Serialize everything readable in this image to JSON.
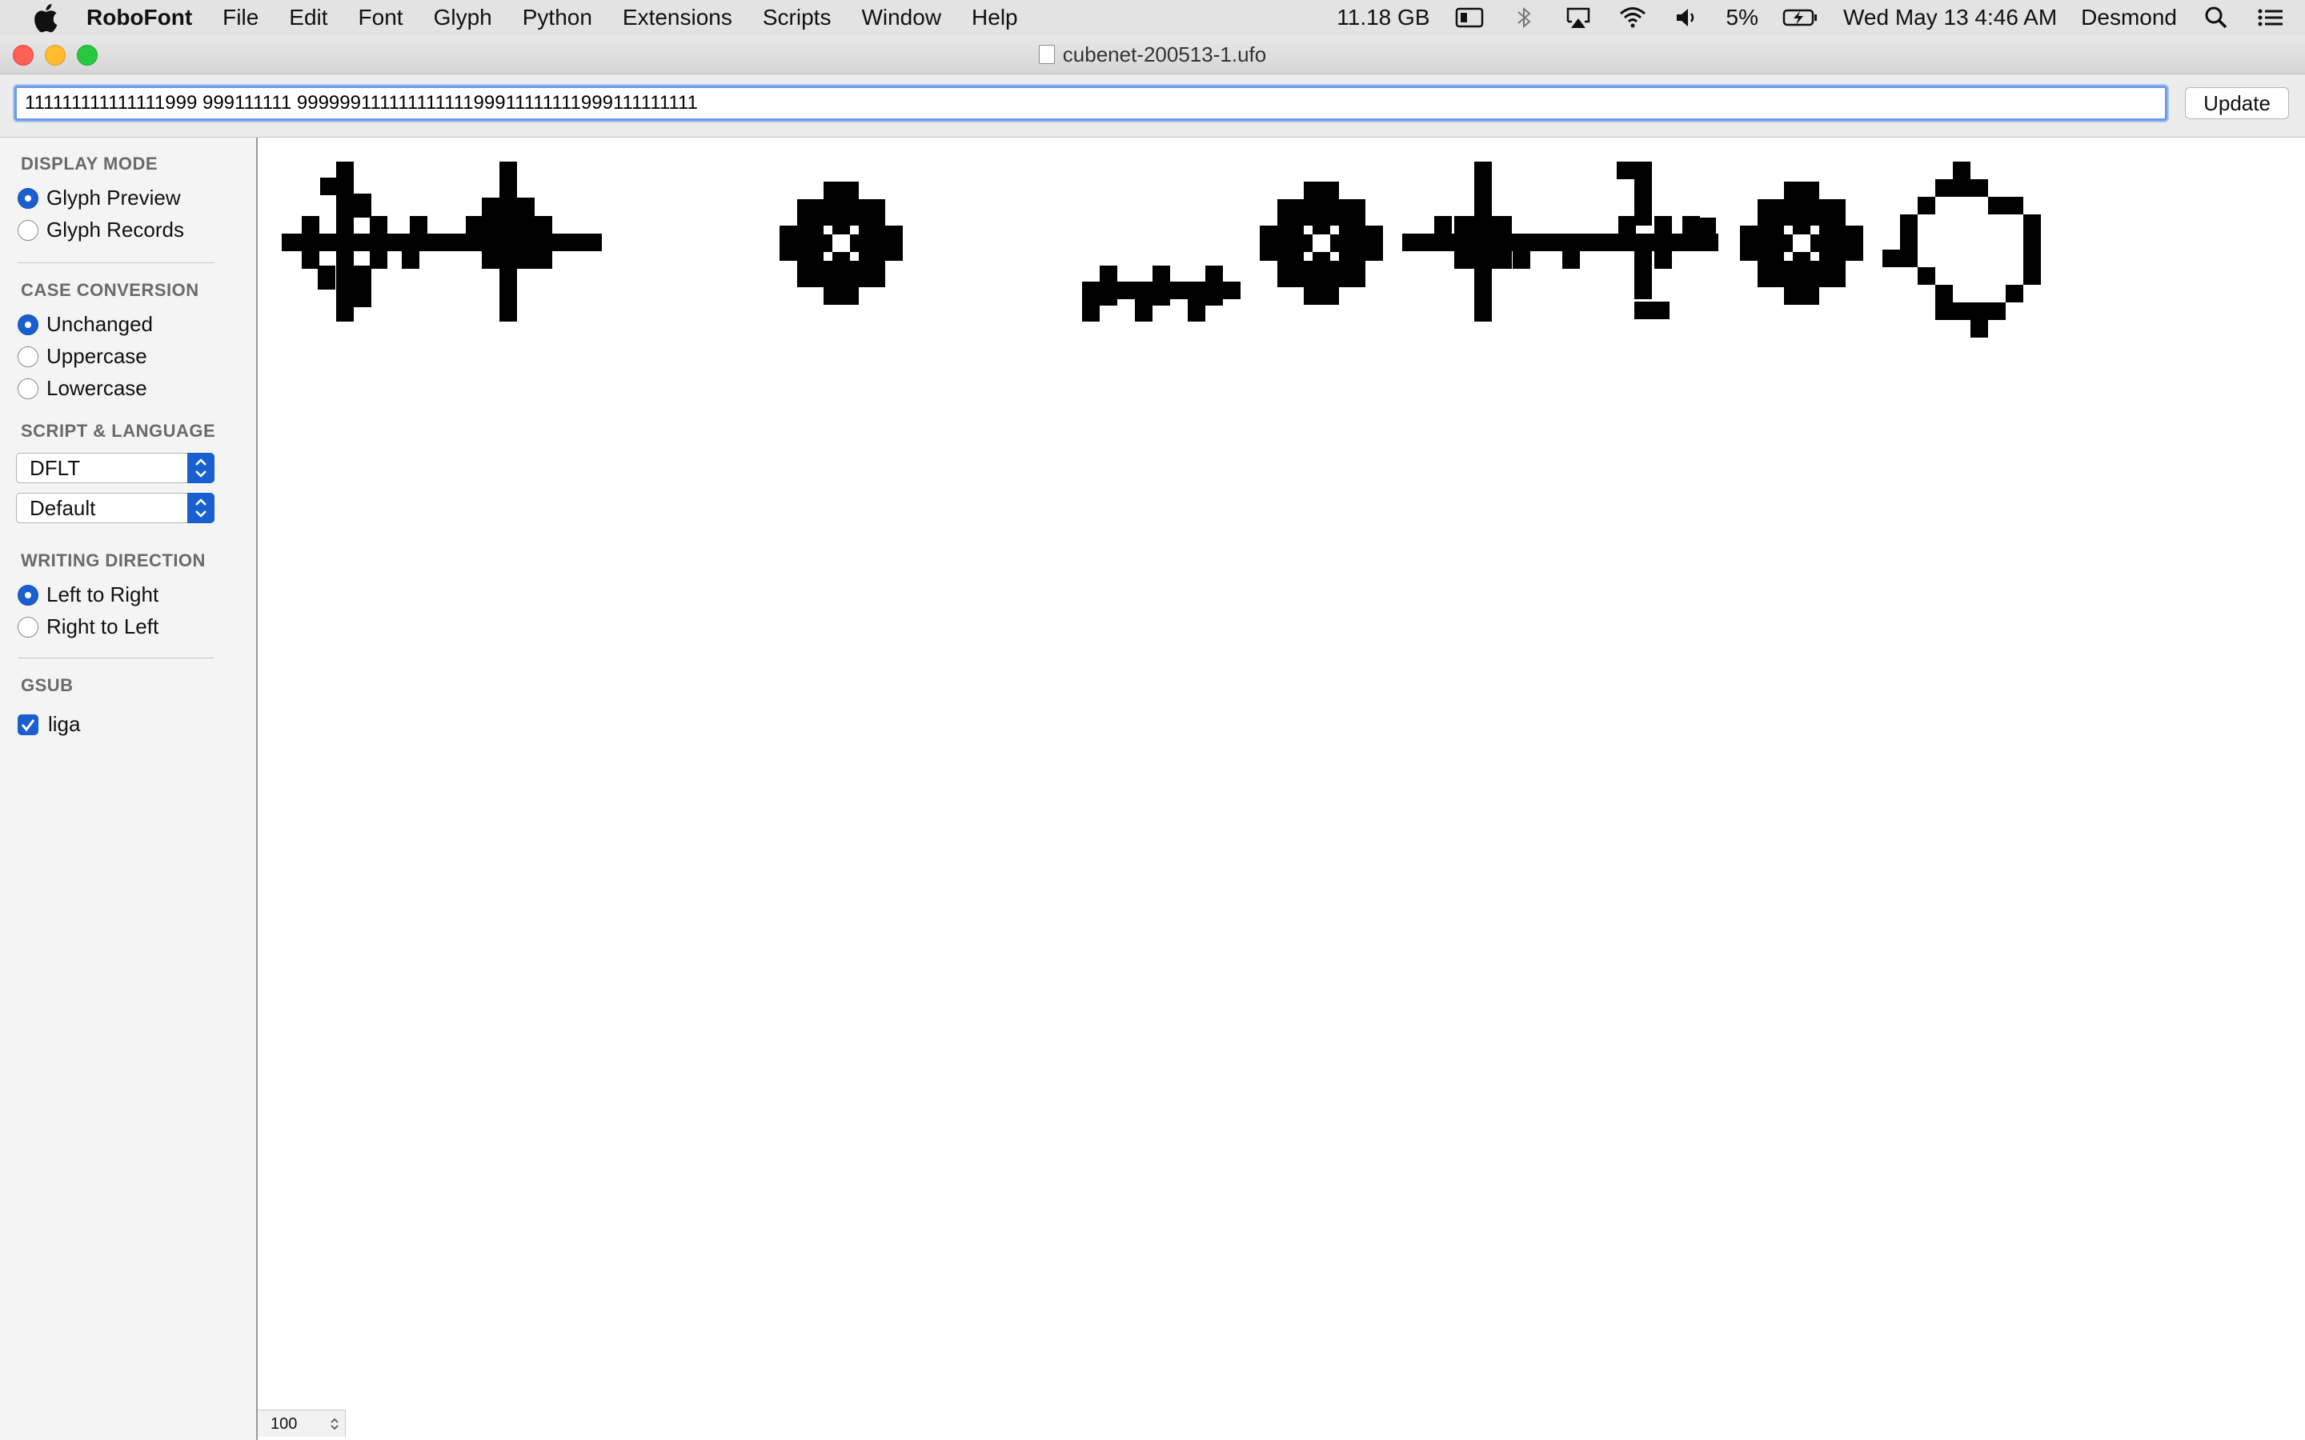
{
  "menubar": {
    "app": "RoboFont",
    "items": [
      "File",
      "Edit",
      "Font",
      "Glyph",
      "Python",
      "Extensions",
      "Scripts",
      "Window",
      "Help"
    ],
    "memory": "11.18 GB",
    "battery": "5%",
    "datetime": "Wed May 13  4:46 AM",
    "user": "Desmond"
  },
  "window": {
    "title": "cubenet-200513-1.ufo"
  },
  "toolbar": {
    "text_value": "111111111111111999 999111111 99999911111111111199911111111999111111111",
    "update_label": "Update"
  },
  "sidebar": {
    "display_mode": {
      "title": "DISPLAY MODE",
      "options": [
        "Glyph Preview",
        "Glyph Records"
      ],
      "selected": 0
    },
    "case_conversion": {
      "title": "CASE CONVERSION",
      "options": [
        "Unchanged",
        "Uppercase",
        "Lowercase"
      ],
      "selected": 0
    },
    "script_language": {
      "title": "SCRIPT & LANGUAGE",
      "script": "DFLT",
      "language": "Default"
    },
    "writing_direction": {
      "title": "WRITING DIRECTION",
      "options": [
        "Left to Right",
        "Right to Left"
      ],
      "selected": 0
    },
    "gsub": {
      "title": "GSUB",
      "feature": "liga",
      "checked": true
    }
  },
  "canvas": {
    "zoom": "100"
  },
  "colors": {
    "accent": "#1a5fd0",
    "focus_ring": "#6d99e8",
    "glyph": "#000000"
  }
}
